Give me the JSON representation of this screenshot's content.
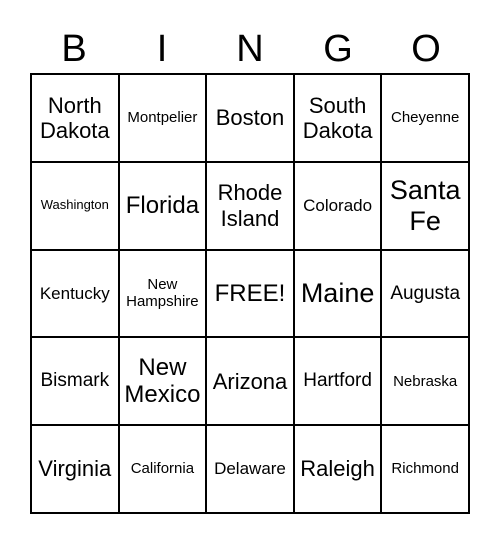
{
  "header": [
    "B",
    "I",
    "N",
    "G",
    "O"
  ],
  "cells": [
    [
      "North Dakota",
      "Montpelier",
      "Boston",
      "South Dakota",
      "Cheyenne"
    ],
    [
      "Washington",
      "Florida",
      "Rhode Island",
      "Colorado",
      "Santa Fe"
    ],
    [
      "Kentucky",
      "New Hampshire",
      "FREE!",
      "Maine",
      "Augusta"
    ],
    [
      "Bismark",
      "New Mexico",
      "Arizona",
      "Hartford",
      "Nebraska"
    ],
    [
      "Virginia",
      "California",
      "Delaware",
      "Raleigh",
      "Richmond"
    ]
  ]
}
